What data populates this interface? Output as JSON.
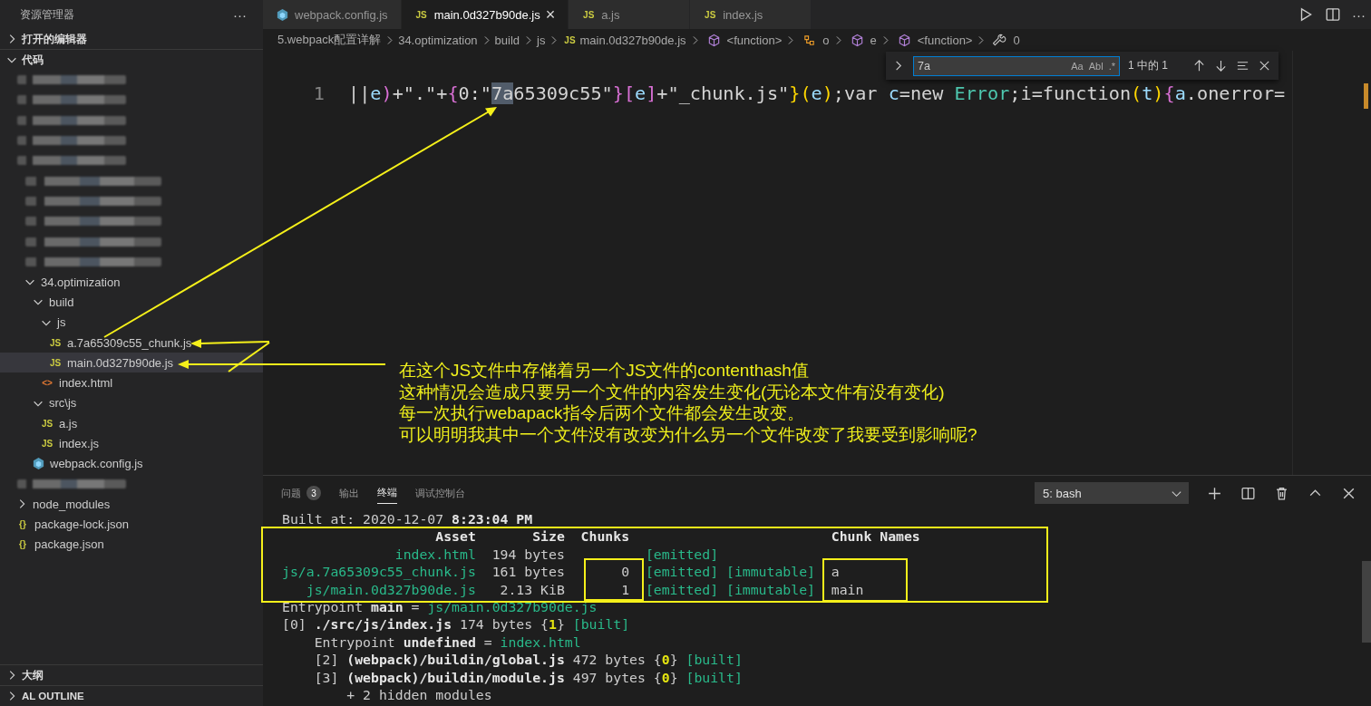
{
  "sidebar": {
    "title": "资源管理器",
    "more": "···",
    "sections": [
      {
        "label": "打开的编辑器",
        "expanded": false
      },
      {
        "label": "代码",
        "expanded": true,
        "tree": [
          {
            "kind": "redacted",
            "selected": false
          },
          {
            "kind": "redacted",
            "selected": false
          },
          {
            "kind": "redacted",
            "selected": false
          },
          {
            "kind": "redacted",
            "selected": false
          },
          {
            "kind": "redacted",
            "selected": false,
            "children": [
              {
                "kind": "redacted",
                "selected": false
              },
              {
                "kind": "redacted",
                "selected": false
              },
              {
                "kind": "redacted",
                "selected": false
              },
              {
                "kind": "redacted",
                "selected": false
              },
              {
                "kind": "redacted",
                "selected": false
              },
              {
                "kind": "folder",
                "label": "34.optimization",
                "expanded": true,
                "selected": false,
                "children": [
                  {
                    "kind": "folder",
                    "label": "build",
                    "expanded": true,
                    "selected": false,
                    "children": [
                      {
                        "kind": "folder",
                        "label": "js",
                        "expanded": true,
                        "selected": false,
                        "children": [
                          {
                            "kind": "script",
                            "label": "a.7a65309c55_chunk.js",
                            "badge": "JS",
                            "selected": false
                          },
                          {
                            "kind": "script",
                            "label": "main.0d327b90de.js",
                            "badge": "JS",
                            "selected": true
                          }
                        ]
                      },
                      {
                        "kind": "markup",
                        "label": "index.html",
                        "badge": "<>",
                        "selected": false
                      }
                    ]
                  },
                  {
                    "kind": "folder",
                    "label": "src\\js",
                    "expanded": true,
                    "selected": false,
                    "children": [
                      {
                        "kind": "script",
                        "label": "a.js",
                        "badge": "JS",
                        "selected": false
                      },
                      {
                        "kind": "script",
                        "label": "index.js",
                        "badge": "JS",
                        "selected": false
                      }
                    ]
                  },
                  {
                    "kind": "config",
                    "label": "webpack.config.js",
                    "selected": false
                  }
                ]
              }
            ]
          },
          {
            "kind": "redacted",
            "selected": false
          },
          {
            "kind": "folder",
            "label": "node_modules",
            "expanded": false,
            "selected": false
          },
          {
            "kind": "data",
            "label": "package-lock.json",
            "badge": "{}",
            "selected": false
          },
          {
            "kind": "data",
            "label": "package.json",
            "badge": "{}",
            "selected": false
          }
        ]
      }
    ],
    "bottom_sections": [
      {
        "label": "大纲",
        "expanded": false
      },
      {
        "label": "AL OUTLINE",
        "expanded": false
      }
    ]
  },
  "tabs": [
    {
      "label": "webpack.config.js",
      "kind": "config",
      "selected": false
    },
    {
      "label": "main.0d327b90de.js",
      "kind": "script",
      "badge": "JS",
      "selected": true,
      "close": "×"
    },
    {
      "label": "a.js",
      "kind": "script",
      "badge": "JS",
      "selected": false
    },
    {
      "label": "index.js",
      "kind": "script",
      "badge": "JS",
      "selected": false
    }
  ],
  "editor_actions": {
    "more": "···"
  },
  "breadcrumbs": [
    {
      "label": "5.webpack配置详解",
      "kind": "path"
    },
    {
      "label": "34.optimization",
      "kind": "path"
    },
    {
      "label": "build",
      "kind": "path"
    },
    {
      "label": "js",
      "kind": "path"
    },
    {
      "label": "main.0d327b90de.js",
      "kind": "script",
      "badge": "JS"
    },
    {
      "label": "<function>",
      "kind": "symbol"
    },
    {
      "label": "o",
      "kind": "field"
    },
    {
      "label": "e",
      "kind": "symbol"
    },
    {
      "label": "<function>",
      "kind": "symbol"
    },
    {
      "label": "0",
      "kind": "constant"
    }
  ],
  "editor": {
    "line_number": "1",
    "tokens": [
      {
        "text": "||",
        "kind": "plain"
      },
      {
        "text": "e",
        "kind": "var"
      },
      {
        "text": ")",
        "kind": "bracket"
      },
      {
        "text": "+\".\"+",
        "kind": "plain"
      },
      {
        "text": "{",
        "kind": "bracket"
      },
      {
        "text": "0:\"",
        "kind": "plain"
      },
      {
        "text": "7a",
        "kind": "match"
      },
      {
        "text": "65309c55\"",
        "kind": "plain"
      },
      {
        "text": "}",
        "kind": "bracket"
      },
      {
        "text": "[",
        "kind": "bracket"
      },
      {
        "text": "e",
        "kind": "var"
      },
      {
        "text": "]",
        "kind": "bracket"
      },
      {
        "text": "+\"_chunk.js\"",
        "kind": "plain"
      },
      {
        "text": "}",
        "kind": "paren"
      },
      {
        "text": "(",
        "kind": "paren"
      },
      {
        "text": "e",
        "kind": "var"
      },
      {
        "text": ")",
        "kind": "paren"
      },
      {
        "text": ";var ",
        "kind": "plain"
      },
      {
        "text": "c",
        "kind": "var"
      },
      {
        "text": "=new ",
        "kind": "plain"
      },
      {
        "text": "Error",
        "kind": "type"
      },
      {
        "text": ";i=function",
        "kind": "plain"
      },
      {
        "text": "(",
        "kind": "paren"
      },
      {
        "text": "t",
        "kind": "var"
      },
      {
        "text": ")",
        "kind": "paren"
      },
      {
        "text": "{",
        "kind": "bracket"
      },
      {
        "text": "a",
        "kind": "var"
      },
      {
        "text": ".onerror=",
        "kind": "plain"
      }
    ]
  },
  "find": {
    "value": "7a",
    "options": [
      "Aa",
      "Abl",
      ".*"
    ],
    "result": "1 中的 1"
  },
  "annotation": {
    "lines": [
      "在这个JS文件中存储着另一个JS文件的contenthash值",
      "这种情况会造成只要另一个文件的内容发生变化(无论本文件有没有变化)",
      "每一次执行webapack指令后两个文件都会发生改变。",
      "可以明明我其中一个文件没有改变为什么另一个文件改变了我要受到影响呢?"
    ]
  },
  "panel": {
    "tabs": [
      {
        "label": "问题",
        "badge": "3",
        "selected": false
      },
      {
        "label": "输出",
        "selected": false
      },
      {
        "label": "终端",
        "selected": true
      },
      {
        "label": "调试控制台",
        "selected": false
      }
    ],
    "terminal_select": "5: bash",
    "lines": [
      [
        {
          "text": "Built at: 2020-12-07 ",
          "kind": "plain"
        },
        {
          "text": "8:23:04 PM",
          "kind": "bold"
        }
      ],
      [
        {
          "text": "                   Asset       Size  Chunks                         Chunk Names",
          "kind": "bold"
        }
      ],
      [
        {
          "text": "              index.html",
          "kind": "green"
        },
        {
          "text": "  194 bytes          ",
          "kind": "plain"
        },
        {
          "text": "[emitted]",
          "kind": "green"
        }
      ],
      [
        {
          "text": "js/a.7a65309c55_chunk.js",
          "kind": "green"
        },
        {
          "text": "  161 bytes       0  ",
          "kind": "plain"
        },
        {
          "text": "[emitted] [immutable]",
          "kind": "green"
        },
        {
          "text": "  a",
          "kind": "plain"
        }
      ],
      [
        {
          "text": "   js/main.0d327b90de.js",
          "kind": "green"
        },
        {
          "text": "   2.13 KiB       1  ",
          "kind": "plain"
        },
        {
          "text": "[emitted] [immutable]",
          "kind": "green"
        },
        {
          "text": "  main",
          "kind": "plain"
        }
      ],
      [
        {
          "text": "Entrypoint ",
          "kind": "plain"
        },
        {
          "text": "main",
          "kind": "bold"
        },
        {
          "text": " = ",
          "kind": "plain"
        },
        {
          "text": "js/main.0d327b90de.js",
          "kind": "green"
        }
      ],
      [
        {
          "text": "[0] ",
          "kind": "plain"
        },
        {
          "text": "./src/js/index.js",
          "kind": "bold"
        },
        {
          "text": " 174 bytes {",
          "kind": "plain"
        },
        {
          "text": "1",
          "kind": "yellow"
        },
        {
          "text": "} ",
          "kind": "plain"
        },
        {
          "text": "[built]",
          "kind": "green"
        }
      ],
      [
        {
          "text": "    Entrypoint ",
          "kind": "plain"
        },
        {
          "text": "undefined",
          "kind": "bold"
        },
        {
          "text": " = ",
          "kind": "plain"
        },
        {
          "text": "index.html",
          "kind": "green"
        }
      ],
      [
        {
          "text": "    [2] ",
          "kind": "plain"
        },
        {
          "text": "(webpack)/buildin/global.js",
          "kind": "bold"
        },
        {
          "text": " 472 bytes {",
          "kind": "plain"
        },
        {
          "text": "0",
          "kind": "yellow"
        },
        {
          "text": "} ",
          "kind": "plain"
        },
        {
          "text": "[built]",
          "kind": "green"
        }
      ],
      [
        {
          "text": "    [3] ",
          "kind": "plain"
        },
        {
          "text": "(webpack)/buildin/module.js",
          "kind": "bold"
        },
        {
          "text": " 497 bytes {",
          "kind": "plain"
        },
        {
          "text": "0",
          "kind": "yellow"
        },
        {
          "text": "} ",
          "kind": "plain"
        },
        {
          "text": "[built]",
          "kind": "green"
        }
      ],
      [
        {
          "text": "        + 2 hidden modules",
          "kind": "plain"
        }
      ]
    ]
  }
}
